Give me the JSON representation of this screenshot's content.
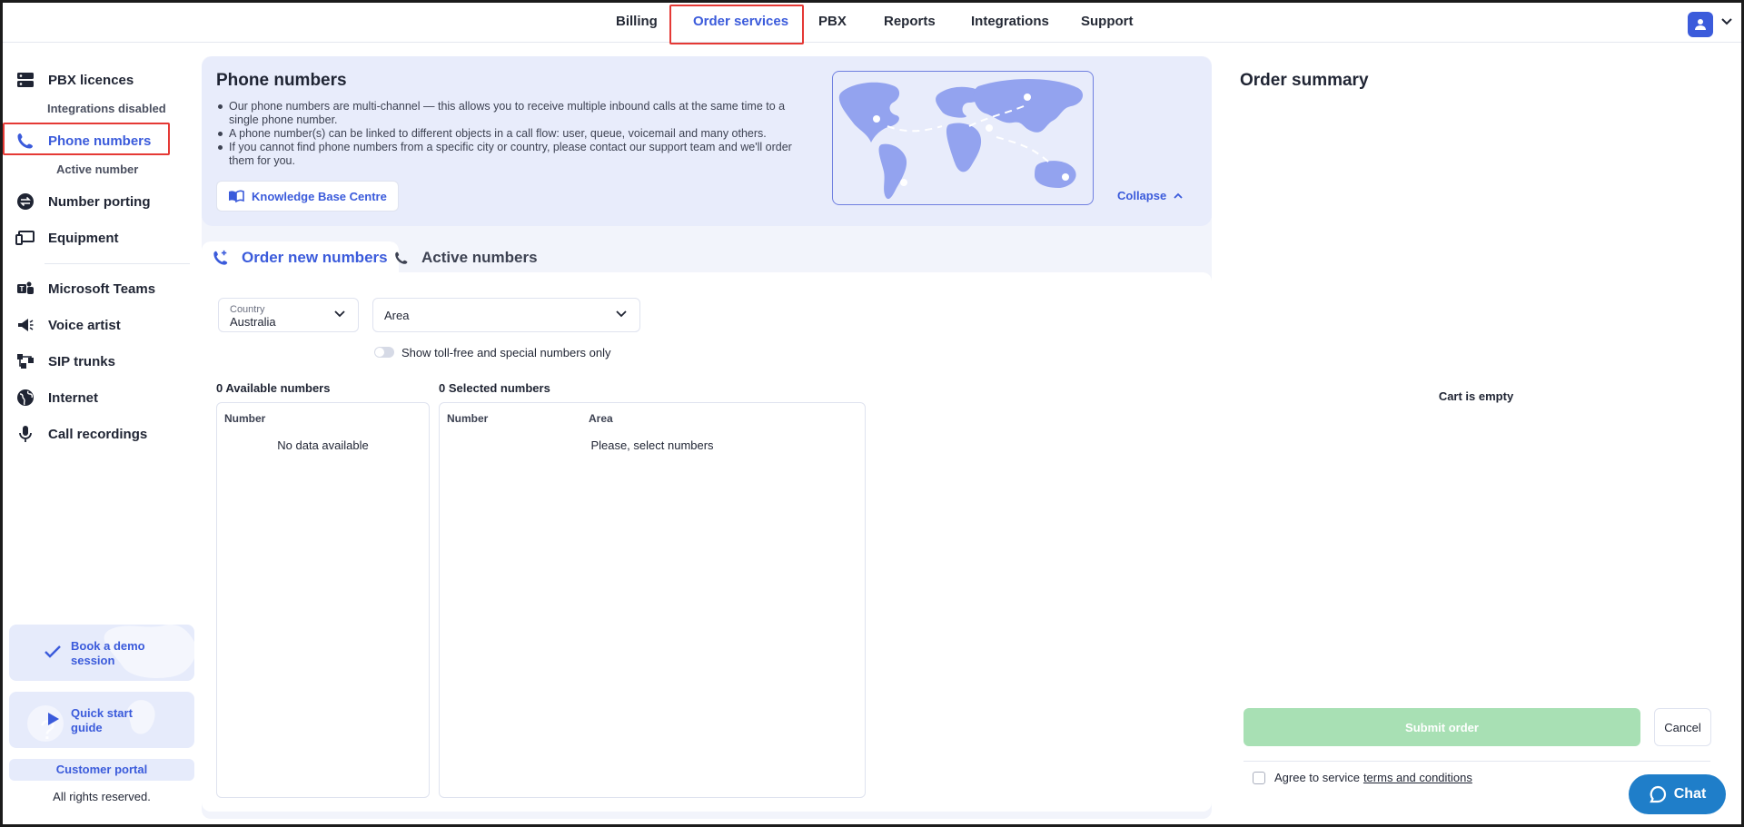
{
  "topnav": {
    "items": [
      {
        "label": "Billing"
      },
      {
        "label": "Order services"
      },
      {
        "label": "PBX"
      },
      {
        "label": "Reports"
      },
      {
        "label": "Integrations"
      },
      {
        "label": "Support"
      }
    ],
    "active": "Order services"
  },
  "sidebar": {
    "items": [
      {
        "label": "PBX licences",
        "sub": "Integrations disabled"
      },
      {
        "label": "Phone numbers",
        "sub": "Active number"
      },
      {
        "label": "Number porting"
      },
      {
        "label": "Equipment"
      },
      {
        "label": "Microsoft Teams"
      },
      {
        "label": "Voice artist"
      },
      {
        "label": "SIP trunks"
      },
      {
        "label": "Internet"
      },
      {
        "label": "Call recordings"
      }
    ],
    "promo_demo": "Book a demo session",
    "promo_guide": "Quick start guide",
    "customer_portal": "Customer portal",
    "rights": "All rights reserved."
  },
  "info": {
    "title": "Phone numbers",
    "bullets": [
      "Our phone numbers are multi-channel — this allows you to receive multiple inbound calls at the same time to a single phone number.",
      "A phone number(s) can be linked to different objects in a call flow: user, queue, voicemail and many others.",
      "If you cannot find phone numbers from a specific city or country, please contact our support team and we'll order them for you."
    ],
    "kb_button": "Knowledge Base Centre",
    "collapse": "Collapse"
  },
  "tabs": {
    "order_new": "Order new numbers",
    "active": "Active numbers"
  },
  "filters": {
    "country_label": "Country",
    "country_value": "Australia",
    "area_placeholder": "Area",
    "toggle_label": "Show toll-free and special numbers only"
  },
  "available": {
    "count_label": "0 Available numbers",
    "col_number": "Number",
    "empty": "No data available"
  },
  "selected": {
    "count_label": "0 Selected numbers",
    "col_number": "Number",
    "col_area": "Area",
    "empty": "Please, select numbers"
  },
  "summary": {
    "title": "Order summary",
    "cart_empty": "Cart is empty",
    "submit": "Submit order",
    "cancel": "Cancel",
    "agree_text": "Agree to service",
    "terms_link": "terms and conditions"
  },
  "chat": {
    "label": "Chat"
  },
  "colors": {
    "accent": "#3b5bdb",
    "highlight": "#e53935",
    "submit_disabled": "#a8e0b4",
    "chat": "#1f7ec9"
  }
}
